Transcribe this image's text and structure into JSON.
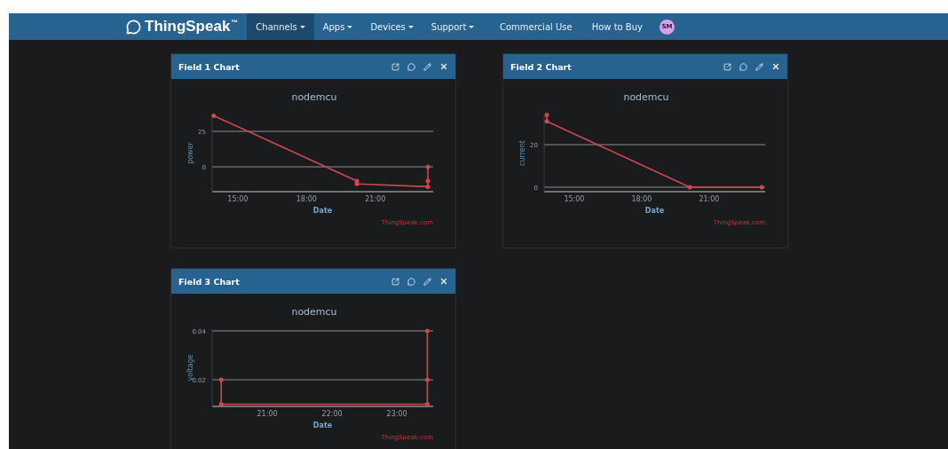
{
  "navbar": {
    "logo": "ThingSpeak",
    "trademark": "™",
    "menus": [
      {
        "label": "Channels",
        "selected": true
      },
      {
        "label": "Apps",
        "selected": false
      },
      {
        "label": "Devices",
        "selected": false
      },
      {
        "label": "Support",
        "selected": false
      }
    ],
    "links": [
      "Commercial Use",
      "How to Buy"
    ],
    "avatar": "SM"
  },
  "panels": [
    {
      "title": "Field 1 Chart",
      "credit": "ThingSpeak.com",
      "chart_data": {
        "type": "line",
        "title": "nodemcu",
        "xlabel": "Date",
        "ylabel": "power",
        "xlim": [
          13.88,
          23.53
        ],
        "ylim": [
          -17.5,
          36.9
        ],
        "xticks": [
          {
            "value": 15,
            "label": "15:00"
          },
          {
            "value": 18,
            "label": "18:00"
          },
          {
            "value": 21,
            "label": "21:00"
          }
        ],
        "yticks": [
          0,
          25
        ],
        "x": [
          13.95,
          20.2,
          20.2,
          23.3,
          23.3,
          23.3
        ],
        "series": [
          {
            "color": "#d2474c",
            "values": [
              36,
              -10,
              -12,
              -14,
              -10,
              0
            ]
          }
        ]
      }
    },
    {
      "title": "Field 2 Chart",
      "credit": "ThingSpeak.com",
      "chart_data": {
        "type": "line",
        "title": "nodemcu",
        "xlabel": "Date",
        "ylabel": "current",
        "xlim": [
          13.66,
          23.49
        ],
        "ylim": [
          -2.1,
          34.2
        ],
        "xticks": [
          {
            "value": 15,
            "label": "15:00"
          },
          {
            "value": 18,
            "label": "18:00"
          },
          {
            "value": 21,
            "label": "21:00"
          }
        ],
        "yticks": [
          0,
          20
        ],
        "x": [
          13.78,
          13.78,
          20.14,
          23.34
        ],
        "series": [
          {
            "color": "#d2474c",
            "values": [
              34,
              31,
              0,
              0
            ]
          }
        ]
      }
    },
    {
      "title": "Field 3 Chart",
      "credit": "ThingSpeak.com",
      "chart_data": {
        "type": "line",
        "title": "nodemcu",
        "xlabel": "Date",
        "ylabel": "voltage",
        "xlim": [
          20.15,
          23.56
        ],
        "ylim": [
          0.0091,
          0.0407
        ],
        "xticks": [
          {
            "value": 21,
            "label": "21:00"
          },
          {
            "value": 22,
            "label": "22:00"
          },
          {
            "value": 23,
            "label": "23:00"
          }
        ],
        "yticks": [
          {
            "value": 0.02,
            "label": "0.02"
          },
          {
            "value": 0.04,
            "label": "0.04"
          }
        ],
        "x": [
          20.29,
          20.29,
          23.47,
          23.47,
          23.47
        ],
        "series": [
          {
            "color": "#d2474c",
            "values": [
              0.02,
              0.01,
              0.01,
              0.02,
              0.04
            ]
          }
        ]
      }
    }
  ]
}
